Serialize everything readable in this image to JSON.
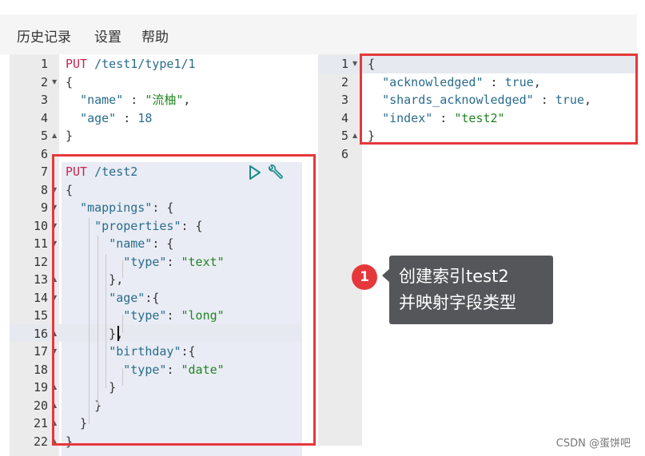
{
  "menu": {
    "history": "历史记录",
    "settings": "设置",
    "help": "帮助"
  },
  "left_editor": {
    "lines": [
      {
        "n": "1",
        "tokens": [
          {
            "t": "method",
            "v": "PUT"
          },
          {
            "t": "punc",
            "v": " "
          },
          {
            "t": "path",
            "v": "/test1/type1/1"
          }
        ]
      },
      {
        "n": "2",
        "tokens": [
          {
            "t": "punc",
            "v": "{"
          }
        ]
      },
      {
        "n": "3",
        "tokens": [
          {
            "t": "punc",
            "v": "  "
          },
          {
            "t": "key",
            "v": "\"name\""
          },
          {
            "t": "punc",
            "v": " : "
          },
          {
            "t": "str",
            "v": "\"流柚\""
          },
          {
            "t": "punc",
            "v": ","
          }
        ]
      },
      {
        "n": "4",
        "tokens": [
          {
            "t": "punc",
            "v": "  "
          },
          {
            "t": "key",
            "v": "\"age\""
          },
          {
            "t": "punc",
            "v": " : "
          },
          {
            "t": "num",
            "v": "18"
          }
        ]
      },
      {
        "n": "5",
        "tokens": [
          {
            "t": "punc",
            "v": "}"
          }
        ]
      },
      {
        "n": "6",
        "tokens": []
      },
      {
        "n": "7",
        "tokens": [
          {
            "t": "method",
            "v": "PUT"
          },
          {
            "t": "punc",
            "v": " "
          },
          {
            "t": "path",
            "v": "/test2"
          }
        ]
      },
      {
        "n": "8",
        "tokens": [
          {
            "t": "punc",
            "v": "{"
          }
        ]
      },
      {
        "n": "9",
        "tokens": [
          {
            "t": "punc",
            "v": "  "
          },
          {
            "t": "key",
            "v": "\"mappings\""
          },
          {
            "t": "punc",
            "v": ": {"
          }
        ]
      },
      {
        "n": "10",
        "tokens": [
          {
            "t": "punc",
            "v": "    "
          },
          {
            "t": "key",
            "v": "\"properties\""
          },
          {
            "t": "punc",
            "v": ": {"
          }
        ]
      },
      {
        "n": "11",
        "tokens": [
          {
            "t": "punc",
            "v": "      "
          },
          {
            "t": "key",
            "v": "\"name\""
          },
          {
            "t": "punc",
            "v": ": {"
          }
        ]
      },
      {
        "n": "12",
        "tokens": [
          {
            "t": "punc",
            "v": "        "
          },
          {
            "t": "key",
            "v": "\"type\""
          },
          {
            "t": "punc",
            "v": ": "
          },
          {
            "t": "str",
            "v": "\"text\""
          }
        ]
      },
      {
        "n": "13",
        "tokens": [
          {
            "t": "punc",
            "v": "      },"
          }
        ]
      },
      {
        "n": "14",
        "tokens": [
          {
            "t": "punc",
            "v": "      "
          },
          {
            "t": "key",
            "v": "\"age\""
          },
          {
            "t": "punc",
            "v": ":{"
          }
        ]
      },
      {
        "n": "15",
        "tokens": [
          {
            "t": "punc",
            "v": "        "
          },
          {
            "t": "key",
            "v": "\"type\""
          },
          {
            "t": "punc",
            "v": ": "
          },
          {
            "t": "str",
            "v": "\"long\""
          }
        ]
      },
      {
        "n": "16",
        "tokens": [
          {
            "t": "punc",
            "v": "      },"
          }
        ]
      },
      {
        "n": "17",
        "tokens": [
          {
            "t": "punc",
            "v": "      "
          },
          {
            "t": "key",
            "v": "\"birthday\""
          },
          {
            "t": "punc",
            "v": ":{"
          }
        ]
      },
      {
        "n": "18",
        "tokens": [
          {
            "t": "punc",
            "v": "        "
          },
          {
            "t": "key",
            "v": "\"type\""
          },
          {
            "t": "punc",
            "v": ": "
          },
          {
            "t": "str",
            "v": "\"date\""
          }
        ]
      },
      {
        "n": "19",
        "tokens": [
          {
            "t": "punc",
            "v": "      }"
          }
        ]
      },
      {
        "n": "20",
        "tokens": [
          {
            "t": "punc",
            "v": "    }"
          }
        ]
      },
      {
        "n": "21",
        "tokens": [
          {
            "t": "punc",
            "v": "  }"
          }
        ]
      },
      {
        "n": "22",
        "tokens": [
          {
            "t": "punc",
            "v": "}"
          }
        ]
      }
    ]
  },
  "right_editor": {
    "lines": [
      {
        "n": "1",
        "tokens": [
          {
            "t": "punc",
            "v": "{"
          }
        ]
      },
      {
        "n": "2",
        "tokens": [
          {
            "t": "punc",
            "v": "  "
          },
          {
            "t": "key",
            "v": "\"acknowledged\""
          },
          {
            "t": "punc",
            "v": " : "
          },
          {
            "t": "bool",
            "v": "true"
          },
          {
            "t": "punc",
            "v": ","
          }
        ]
      },
      {
        "n": "3",
        "tokens": [
          {
            "t": "punc",
            "v": "  "
          },
          {
            "t": "key",
            "v": "\"shards_acknowledged\""
          },
          {
            "t": "punc",
            "v": " : "
          },
          {
            "t": "bool",
            "v": "true"
          },
          {
            "t": "punc",
            "v": ","
          }
        ]
      },
      {
        "n": "4",
        "tokens": [
          {
            "t": "punc",
            "v": "  "
          },
          {
            "t": "key",
            "v": "\"index\""
          },
          {
            "t": "punc",
            "v": " : "
          },
          {
            "t": "str",
            "v": "\"test2\""
          }
        ]
      },
      {
        "n": "5",
        "tokens": [
          {
            "t": "punc",
            "v": "}"
          }
        ]
      },
      {
        "n": "6",
        "tokens": []
      }
    ]
  },
  "annotation": {
    "badge": "1",
    "line1": "创建索引test2",
    "line2": "并映射字段类型"
  },
  "watermark": "CSDN @蛋饼吧",
  "colors": {
    "highlight_box": "#e5383b",
    "tooltip_bg": "#545659",
    "method": "#c7254e",
    "key": "#2a6c8c",
    "string": "#218521"
  }
}
